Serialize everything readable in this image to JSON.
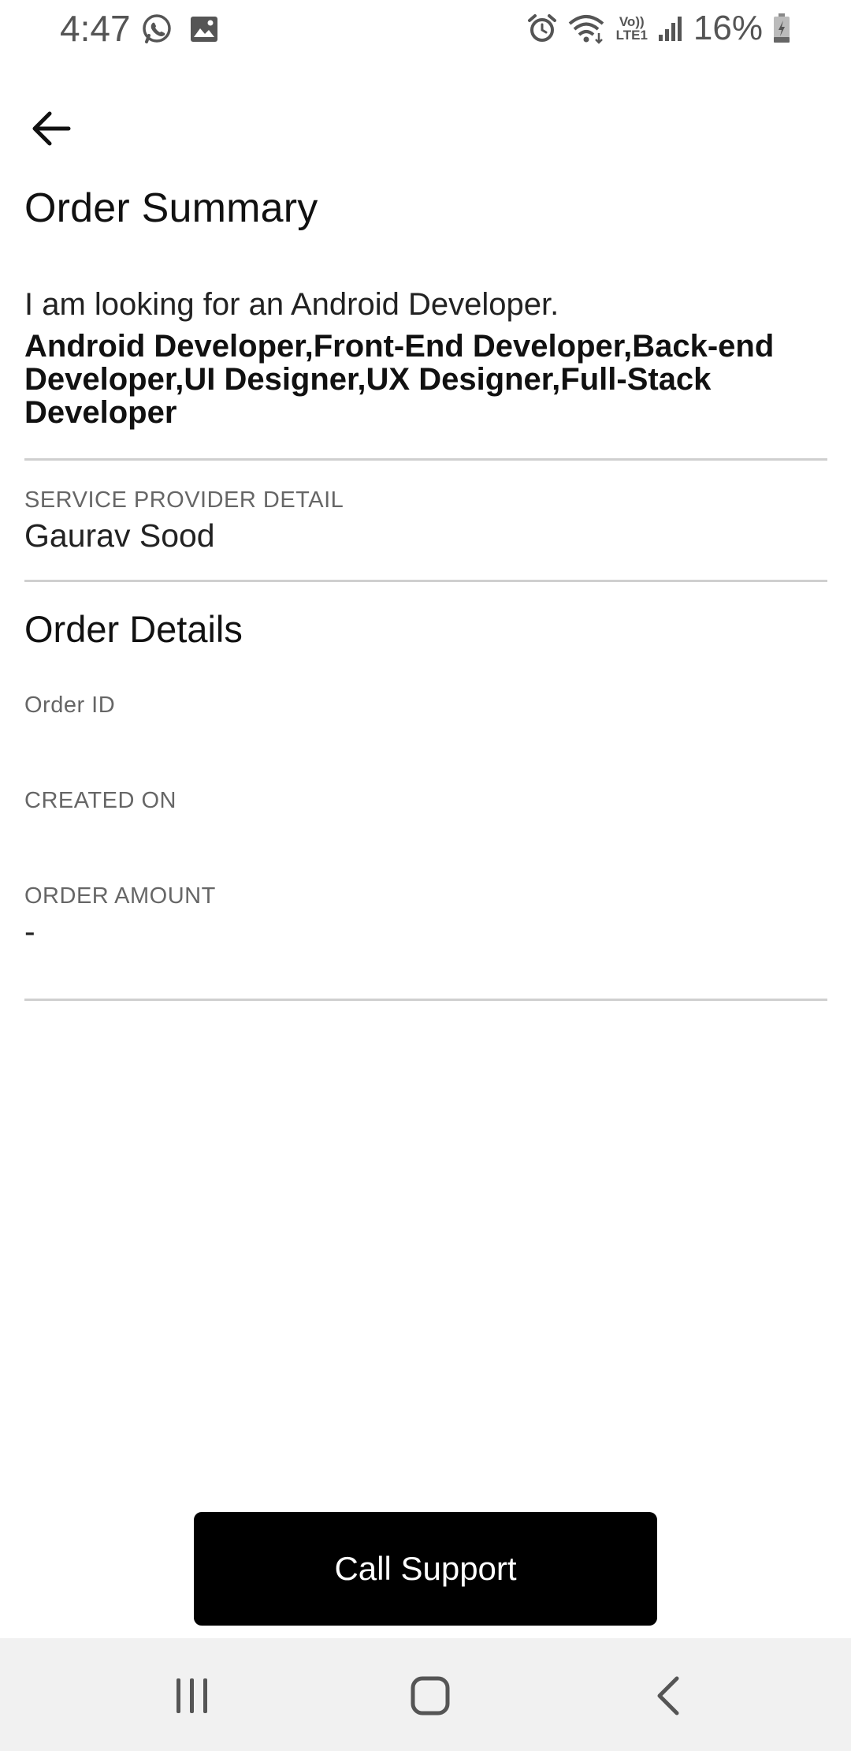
{
  "status_bar": {
    "time": "4:47",
    "network_label_top": "Vo))",
    "network_label_bottom": "LTE1",
    "battery_percent": "16%",
    "left_icons": [
      "whatsapp-icon",
      "gallery-icon"
    ],
    "right_icons": [
      "alarm-icon",
      "wifi-icon",
      "signal-icon",
      "battery-icon"
    ]
  },
  "header": {
    "back_icon": "arrow-left-icon",
    "title": "Order Summary"
  },
  "request": {
    "description": "I am looking for an Android Developer.",
    "roles": "Android Developer,Front-End Developer,Back-end Developer,UI Designer,UX Designer,Full-Stack Developer"
  },
  "provider": {
    "label": "SERVICE PROVIDER DETAIL",
    "name": "Gaurav Sood"
  },
  "order_details": {
    "title": "Order Details",
    "order_id_label": "Order ID",
    "order_id_value": "",
    "created_on_label": "CREATED ON",
    "created_on_value": "",
    "amount_label": "ORDER AMOUNT",
    "amount_value": "-"
  },
  "actions": {
    "call_support_label": "Call Support"
  },
  "nav_bar": {
    "icons": [
      "recent-apps-icon",
      "home-icon",
      "back-icon"
    ]
  },
  "colors": {
    "button_bg": "#000000",
    "button_text": "#ffffff",
    "divider": "#cfcfcf",
    "nav_bg": "#f1f1f1"
  }
}
